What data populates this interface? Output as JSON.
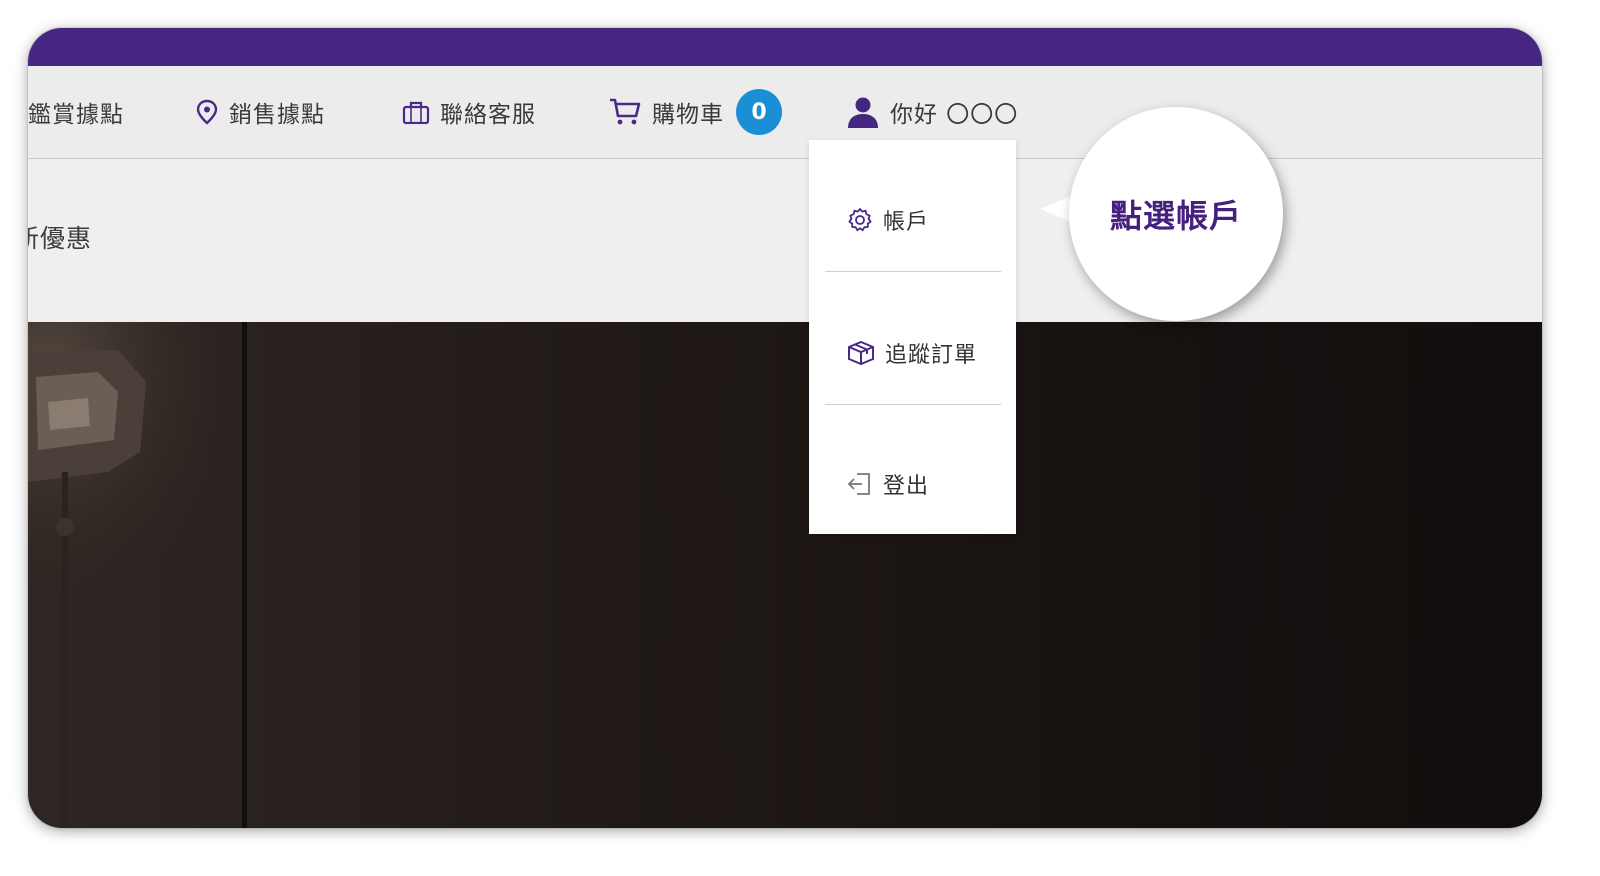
{
  "nav": {
    "view_points": "鑑賞據點",
    "sales_points": "銷售據點",
    "customer_service": "聯絡客服",
    "cart_label": "購物車",
    "cart_count": "0",
    "greeting": "你好 〇〇〇"
  },
  "promo": {
    "text": "新優惠"
  },
  "account_menu": {
    "items": [
      {
        "label": "帳戶",
        "icon": "gear-icon"
      },
      {
        "label": "追蹤訂單",
        "icon": "package-icon"
      },
      {
        "label": "登出",
        "icon": "logout-icon"
      }
    ]
  },
  "callout": {
    "text": "點選帳戶"
  },
  "colors": {
    "brand_purple": "#452680",
    "badge_blue": "#1a8fd6",
    "callout_text": "#45207f"
  }
}
